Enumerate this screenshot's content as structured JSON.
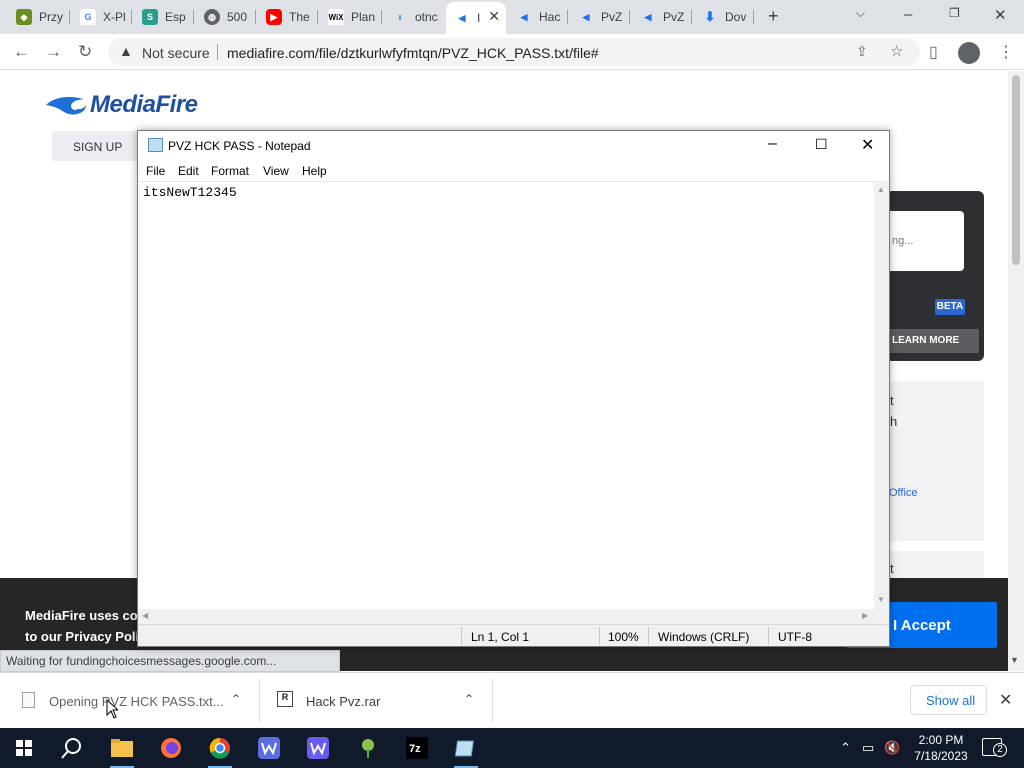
{
  "browser": {
    "tabs": [
      {
        "label": "Przy",
        "icon": "game-icon",
        "color": "#6b8e23"
      },
      {
        "label": "X-Pl",
        "icon": "google-icon",
        "color": "#4285f4"
      },
      {
        "label": "Esp",
        "icon": "esp-icon",
        "color": "#2a9d8f"
      },
      {
        "label": "500",
        "icon": "globe-icon",
        "color": "#5f6368"
      },
      {
        "label": "The",
        "icon": "youtube-icon",
        "color": "#ff0000"
      },
      {
        "label": "Plan",
        "icon": "wix-icon",
        "color": "#000000"
      },
      {
        "label": "otnc",
        "icon": "dot-icon",
        "color": "#1a73e8"
      },
      {
        "label": "I",
        "icon": "mediafire-icon",
        "color": "#1a73e8"
      },
      {
        "label": "Hac",
        "icon": "mediafire-icon",
        "color": "#1a73e8"
      },
      {
        "label": "PvZ",
        "icon": "mediafire-icon",
        "color": "#1a73e8"
      },
      {
        "label": "PvZ",
        "icon": "mediafire-icon",
        "color": "#1a73e8"
      },
      {
        "label": "Dov",
        "icon": "download-icon",
        "color": "#1a73e8"
      }
    ],
    "address": {
      "security": "Not secure",
      "url": "mediafire.com/file/dztkurlwfyfmtqn/PVZ_HCK_PASS.txt/file#"
    },
    "status_text": "Waiting for fundingchoicesmessages.google.com..."
  },
  "page": {
    "logo_text": "MediaFire",
    "signup": "SIGN UP",
    "loading_text": "ng...",
    "beta": "BETA",
    "learn_more": "LEARN MORE",
    "side_text_1": "t",
    "side_text_2": "h",
    "office_link": "Office",
    "side_text_3": "t",
    "cookie_line1": "MediaFire uses coo",
    "cookie_line2": "to our Privacy Polic",
    "accept": "I Accept"
  },
  "notepad": {
    "title": "PVZ HCK PASS - Notepad",
    "menu": [
      "File",
      "Edit",
      "Format",
      "View",
      "Help"
    ],
    "content": "itsNewT12345",
    "status": {
      "position": "Ln 1, Col 1",
      "zoom": "100%",
      "line_endings": "Windows (CRLF)",
      "encoding": "UTF-8"
    }
  },
  "downloads": {
    "items": [
      {
        "name": "Opening PVZ HCK PASS.txt..."
      },
      {
        "name": "Hack Pvz.rar"
      }
    ],
    "show_all": "Show all"
  },
  "taskbar": {
    "time": "2:00 PM",
    "date": "7/18/2023",
    "notifications": "2"
  }
}
